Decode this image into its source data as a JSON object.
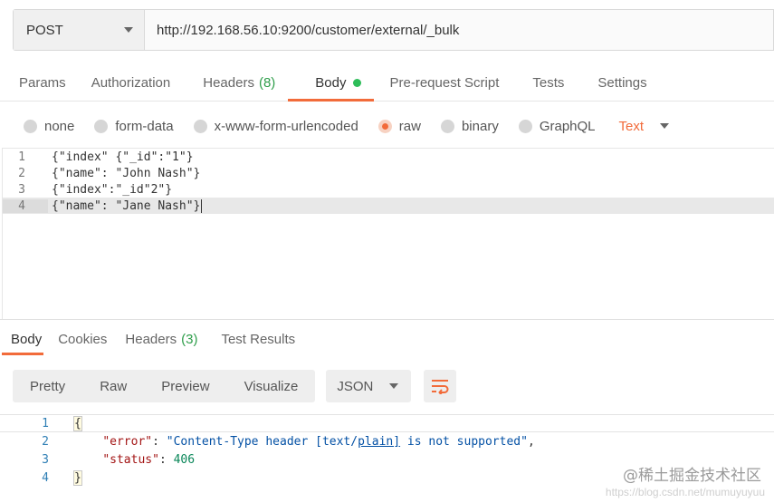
{
  "request": {
    "method": "POST",
    "url": "http://192.168.56.10:9200/customer/external/_bulk"
  },
  "request_tabs": [
    {
      "label": "Params"
    },
    {
      "label": "Authorization"
    },
    {
      "label": "Headers",
      "count": "(8)"
    },
    {
      "label": "Body",
      "active": true
    },
    {
      "label": "Pre-request Script"
    },
    {
      "label": "Tests"
    },
    {
      "label": "Settings"
    }
  ],
  "body_types": {
    "none": "none",
    "form_data": "form-data",
    "urlencoded": "x-www-form-urlencoded",
    "raw": "raw",
    "binary": "binary",
    "graphql": "GraphQL",
    "selected": "raw",
    "raw_format": "Text"
  },
  "editor": {
    "lines": [
      {
        "num": "1",
        "text": "{\"index\" {\"_id\":\"1\"}"
      },
      {
        "num": "2",
        "text": "{\"name\": \"John Nash\"}"
      },
      {
        "num": "3",
        "text": "{\"index\":\"_id\"2\"}"
      },
      {
        "num": "4",
        "text": "{\"name\": \"Jane Nash\"}"
      }
    ]
  },
  "response_tabs": {
    "body": "Body",
    "cookies": "Cookies",
    "headers": "Headers",
    "headers_count": "(3)",
    "test_results": "Test Results"
  },
  "response_toolbar": {
    "pretty": "Pretty",
    "raw": "Raw",
    "preview": "Preview",
    "visualize": "Visualize",
    "format": "JSON"
  },
  "response_body": {
    "line_nums": [
      "1",
      "2",
      "3",
      "4"
    ],
    "open_brace": "{",
    "close_brace": "}",
    "error_key": "\"error\"",
    "error_value_before": "\"Content-Type header [text/",
    "error_value_link": "plain]",
    "error_value_after": " is not supported\"",
    "status_key": "\"status\"",
    "status_value": "406"
  },
  "watermark": "@稀土掘金技术社区",
  "watermark_url": "https://blog.csdn.net/mumuyuyuu"
}
